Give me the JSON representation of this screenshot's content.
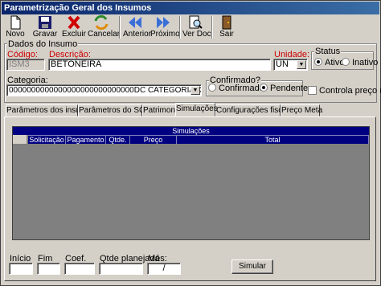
{
  "window": {
    "title": "Parametrização Geral dos Insumos"
  },
  "toolbar": [
    {
      "label": "Novo",
      "icon": "new-document-icon"
    },
    {
      "label": "Gravar",
      "icon": "floppy-disk-icon"
    },
    {
      "label": "Excluir",
      "icon": "red-x-icon"
    },
    {
      "label": "Cancelar",
      "icon": "cancel-arrows-icon"
    },
    {
      "label": "Anterior",
      "icon": "left-arrow-icon"
    },
    {
      "label": "Próximo",
      "icon": "right-arrow-icon"
    },
    {
      "label": "Ver Doc.",
      "icon": "document-magnifier-icon"
    },
    {
      "label": "Sair",
      "icon": "exit-door-icon"
    }
  ],
  "dados": {
    "group_label": "Dados do Insumo",
    "codigo_label": "Código:",
    "codigo_value": "ISM3",
    "descricao_label": "Descrição:",
    "descricao_value": "BETONEIRA",
    "unidade_label": "Unidade:",
    "unidade_value": "UN",
    "status_label": "Status",
    "status_ativo": "Ativo",
    "status_inativo": "Inativo",
    "categoria_label": "Categoria:",
    "categoria_value": "0000000000000000000000000000DC CATEGORIA DE KILOGRAM",
    "confirmado_group": "Confirmado?",
    "confirmado": "Confirmado",
    "pendente": "Pendente",
    "controla_preco": "Controla preço meta"
  },
  "tabs": [
    "Parâmetros dos insumos",
    "Parâmetros do SGQ",
    "Patrimonio",
    "Simulações",
    "Configurações fiscais",
    "Preço Meta"
  ],
  "grid": {
    "caption": "Simulações",
    "columns": [
      "Solicitação",
      "Pagamento",
      "Qtde.",
      "Preço",
      "Total"
    ]
  },
  "simulacao": {
    "inicio_label": "Início",
    "fim_label": "Fim",
    "coef_label": "Coef.",
    "qtde_label": "Qtde planejada",
    "mes_label": "Mês:",
    "mes_value": "/",
    "simular_button": "Simular"
  },
  "colors": {
    "title_start": "#0a246a",
    "grid_header": "#000080",
    "required_label": "#cc0000"
  }
}
